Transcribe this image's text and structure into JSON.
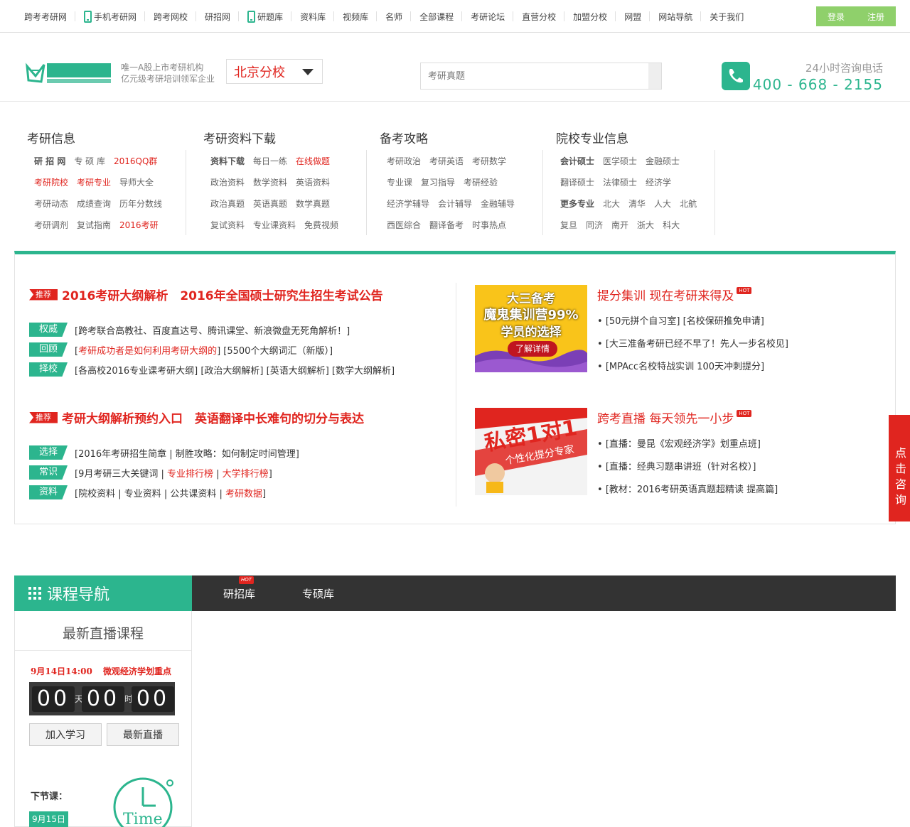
{
  "topnav": {
    "items": [
      "跨考考研网",
      "手机考研网",
      "跨考网校",
      "研招网",
      "研题库",
      "资料库",
      "视频库",
      "名师",
      "全部课程",
      "考研论坛",
      "直营分校",
      "加盟分校",
      "网盟",
      "网站导航",
      "关于我们"
    ],
    "login": "登录",
    "register": "注册"
  },
  "header": {
    "slogan1": "唯一A股上市考研机构",
    "slogan2": "亿元级考研培训领军企业",
    "city": "北京分校",
    "search_placeholder": "考研真题",
    "hotline_label": "24小时咨询电话",
    "hotline": "400 - 668 - 2155"
  },
  "categories": [
    {
      "title": "考研信息",
      "rows": [
        [
          "研 招 网",
          "专 硕 库",
          "2016QQ群"
        ],
        [
          "考研院校",
          "考研专业",
          "导师大全"
        ],
        [
          "考研动态",
          "成绩查询",
          "历年分数线"
        ],
        [
          "考研调剂",
          "复试指南",
          "2016考研"
        ]
      ]
    },
    {
      "title": "考研资料下载",
      "rows": [
        [
          "资料下载",
          "每日一练",
          "在线做题"
        ],
        [
          "政治资料",
          "数学资料",
          "英语资料"
        ],
        [
          "政治真题",
          "英语真题",
          "数学真题"
        ],
        [
          "复试资料",
          "专业课资料",
          "免费视频"
        ]
      ]
    },
    {
      "title": "备考攻略",
      "rows": [
        [
          "考研政治",
          "考研英语",
          "考研数学"
        ],
        [
          "专业课",
          "复习指导",
          "考研经验"
        ],
        [
          "经济学辅导",
          "会计辅导",
          "金融辅导"
        ],
        [
          "西医综合",
          "翻译备考",
          "时事热点"
        ]
      ]
    },
    {
      "title": "院校专业信息",
      "rows": [
        [
          "会计硕士",
          "医学硕士",
          "金融硕士"
        ],
        [
          "翻译硕士",
          "法律硕士",
          "经济学"
        ],
        [
          "更多专业",
          "北大",
          "清华",
          "人大",
          "北航"
        ],
        [
          "复旦",
          "同济",
          "南开",
          "浙大",
          "科大"
        ]
      ]
    }
  ],
  "news": {
    "rec_label": "推荐",
    "h1": "2016考研大纲解析　2016年全国硕士研究生招生考试公告",
    "block1": [
      {
        "tag": "权威",
        "text": "[跨考联合高教社、百度直达号、腾讯课堂、新浪微盘无死角解析！]"
      },
      {
        "tag": "回顾",
        "red": "考研成功者是如何利用考研大纲的",
        "text": "] [5500个大纲词汇（新版）]"
      },
      {
        "tag": "择校",
        "text": "[各高校2016专业课考研大纲] [政治大纲解析] [英语大纲解析] [数学大纲解析]"
      }
    ],
    "h2": "考研大纲解析预约入口　英语翻译中长难句的切分与表达",
    "block2": [
      {
        "tag": "选择",
        "text": "[2016年考研招生简章 | 制胜攻略：如何制定时间管理]"
      },
      {
        "tag": "常识",
        "a": "[9月考研三大关键词 | ",
        "red1": "专业排行榜",
        "b": " | ",
        "red2": "大学排行榜",
        "c": "]"
      },
      {
        "tag": "资料",
        "a": "[院校资料 | 专业资料 | 公共课资料 | ",
        "red1": "考研数据",
        "c": "]"
      }
    ]
  },
  "ads": {
    "ad1": {
      "line1": "大三备考",
      "line2": "魔鬼集训营99%",
      "line3": "学员的选择",
      "btn": "了解详情"
    },
    "ad2": {
      "line1": "私密1对1",
      "line2": "个性化提分专家"
    }
  },
  "right": {
    "hot": "HOT",
    "t1": "提分集训 现在考研来得及",
    "items1": [
      "[50元拼个自习室] [名校保研推免申请]",
      "[大三准备考研已经不早了！先人一步名校见]",
      "[MPAcc名校特战实训 100天冲刺提分]"
    ],
    "t2": "跨考直播 每天领先一小步",
    "items2": [
      "[直播：曼昆《宏观经济学》划重点班]",
      "[直播：经典习题串讲班（针对名校）]",
      "[教材：2016考研英语真题超精读 提高篇]"
    ]
  },
  "consult": "点击咨询",
  "course_nav": {
    "title": "课程导航",
    "tabs": [
      "研招库",
      "专硕库"
    ],
    "live_title": "最新直播课程",
    "live_time": "9月14日14:00",
    "live_name": "微观经济学划重点",
    "cd_day": "00",
    "cd_day_unit": "天",
    "cd_hour": "00",
    "cd_hour_unit": "时",
    "cd_min": "00",
    "join": "加入学习",
    "latest": "最新直播",
    "next_label": "下节课：",
    "next_date": "9月15日",
    "clock_text": "Time"
  },
  "colors": {
    "brand": "#2cb58e",
    "accent": "#e0251f",
    "nav_dark": "#333333"
  }
}
